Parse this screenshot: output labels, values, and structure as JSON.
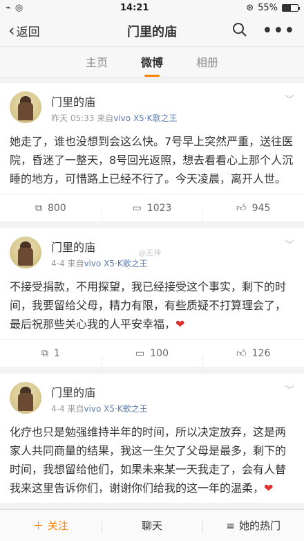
{
  "status": {
    "time": "14:21",
    "battery": "55%",
    "battery_level": 0.55
  },
  "nav": {
    "back_label": "返回",
    "title": "门里的庙"
  },
  "tabs": [
    "主页",
    "微博",
    "相册"
  ],
  "posts": [
    {
      "author": "门里的庙",
      "time": "昨天 05:33",
      "source_prefix": "来自",
      "source": "vivo X5·K歌之王",
      "text": "她走了，谁也没想到会这么快。7号早上突然严重，送往医院，昏迷了一整天，8号回光返照，想去看看心上那个人沉睡的地方，可惜路上已经不行了。今天凌晨，离开人世。",
      "heart": "",
      "repost": "800",
      "comment": "1023",
      "like": "945"
    },
    {
      "author": "门里的庙",
      "time": "4-4",
      "source_prefix": "来自",
      "source": "vivo X5·K歌之王",
      "text": "不接受捐款，不用探望，我已经接受这个事实，剩下的时间，我要留给父母，精力有限，有些质疑不打算理会了，最后祝那些关心我的人平安幸福，",
      "heart": "❤",
      "repost": "1",
      "comment": "100",
      "like": "126"
    },
    {
      "author": "门里的庙",
      "time": "4-4",
      "source_prefix": "来自",
      "source": "vivo X5·K歌之王",
      "text": "化疗也只是勉强维持半年的时间，所以决定放弃，这是两家人共同商量的结果，我这一生欠了父母是最多，剩下的时间，我想留给他们，如果未来某一天我走了，会有人替我来这里告诉你们，谢谢你们给我的这一年的温柔，",
      "heart": "❤"
    }
  ],
  "watermark": "@无神",
  "bottom": {
    "follow": "关注",
    "chat": "聊天",
    "hot": "她的热门"
  },
  "colors": {
    "accent": "#ff8200",
    "link": "#5b7bad",
    "heart": "#e0312e"
  }
}
